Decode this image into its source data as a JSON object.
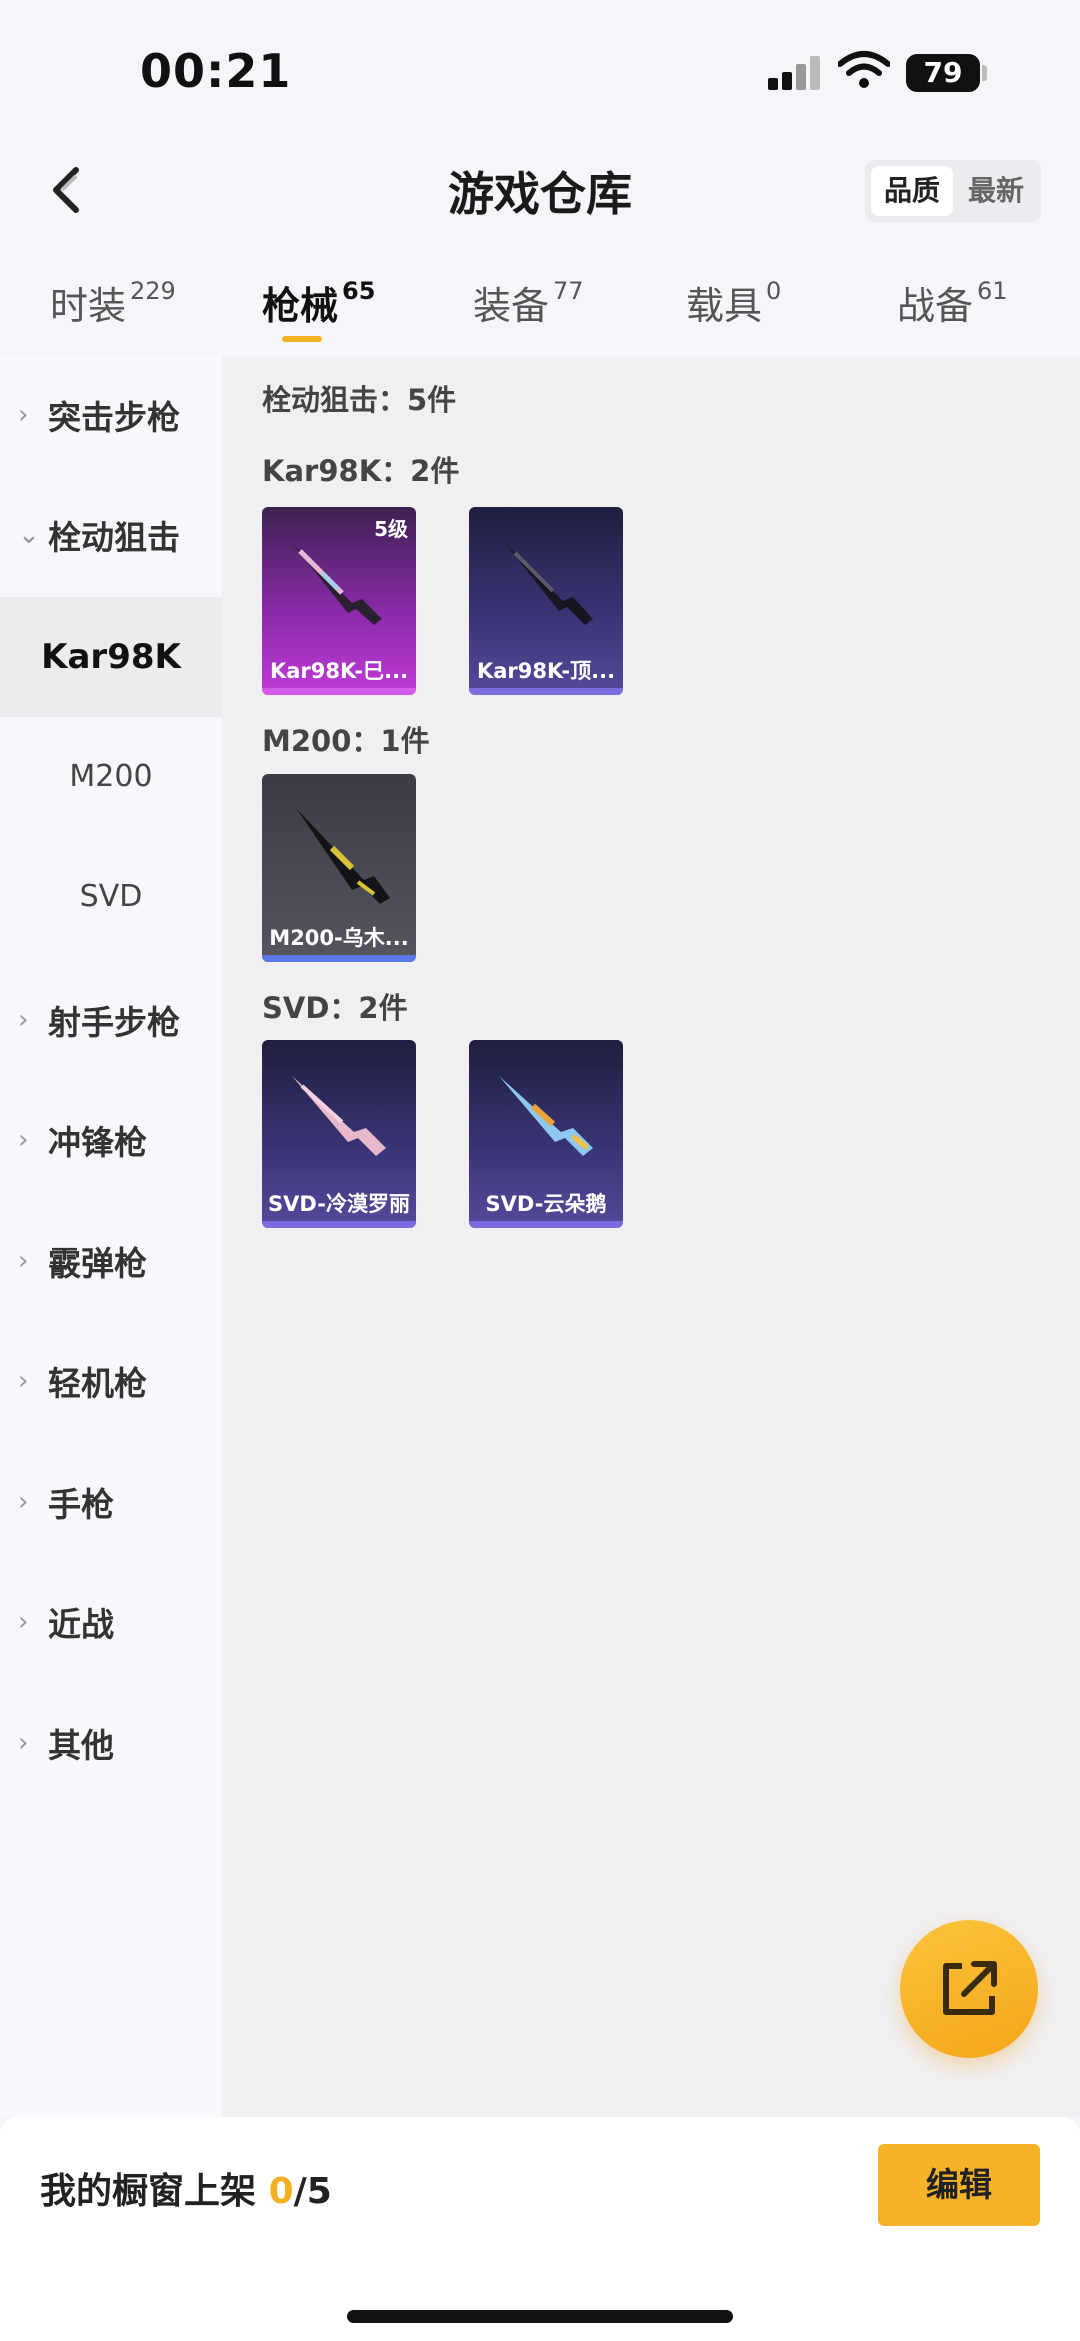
{
  "status": {
    "time": "00:21",
    "battery": "79"
  },
  "header": {
    "title": "游戏仓库",
    "sort_quality": "品质",
    "sort_newest": "最新"
  },
  "tabs": [
    {
      "label": "时装",
      "count": "229"
    },
    {
      "label": "枪械",
      "count": "65"
    },
    {
      "label": "装备",
      "count": "77"
    },
    {
      "label": "载具",
      "count": "0"
    },
    {
      "label": "战备",
      "count": "61"
    }
  ],
  "sidebar": {
    "categories": [
      "突击步枪",
      "栓动狙击",
      "射手步枪",
      "冲锋枪",
      "霰弹枪",
      "轻机枪",
      "手枪",
      "近战",
      "其他"
    ],
    "subcategories": [
      "Kar98K",
      "M200",
      "SVD"
    ]
  },
  "content": {
    "section_title": "栓动狙击：5件",
    "groups": [
      {
        "title": "Kar98K：2件",
        "items": [
          {
            "name": "Kar98K-巳...",
            "level": "5级",
            "rarity": "pink"
          },
          {
            "name": "Kar98K-顶...",
            "rarity": "blue"
          }
        ]
      },
      {
        "title": "M200：1件",
        "items": [
          {
            "name": "M200-乌木...",
            "rarity": "grey"
          }
        ]
      },
      {
        "title": "SVD：2件",
        "items": [
          {
            "name": "SVD-冷漠罗丽",
            "rarity": "blue"
          },
          {
            "name": "SVD-云朵鹅",
            "rarity": "blue"
          }
        ]
      }
    ]
  },
  "bottom": {
    "label": "我的橱窗上架",
    "count": "0",
    "total": "/5",
    "edit_label": "编辑"
  },
  "colors": {
    "accent": "#f5b021",
    "pink_card": "#c03ad6",
    "blue_card": "#3a3678",
    "grey_card": "#55555e"
  },
  "icons": [
    "back-icon",
    "share-icon",
    "chevron-right-icon",
    "chevron-down-icon",
    "signal-icon",
    "wifi-icon",
    "battery-icon"
  ]
}
